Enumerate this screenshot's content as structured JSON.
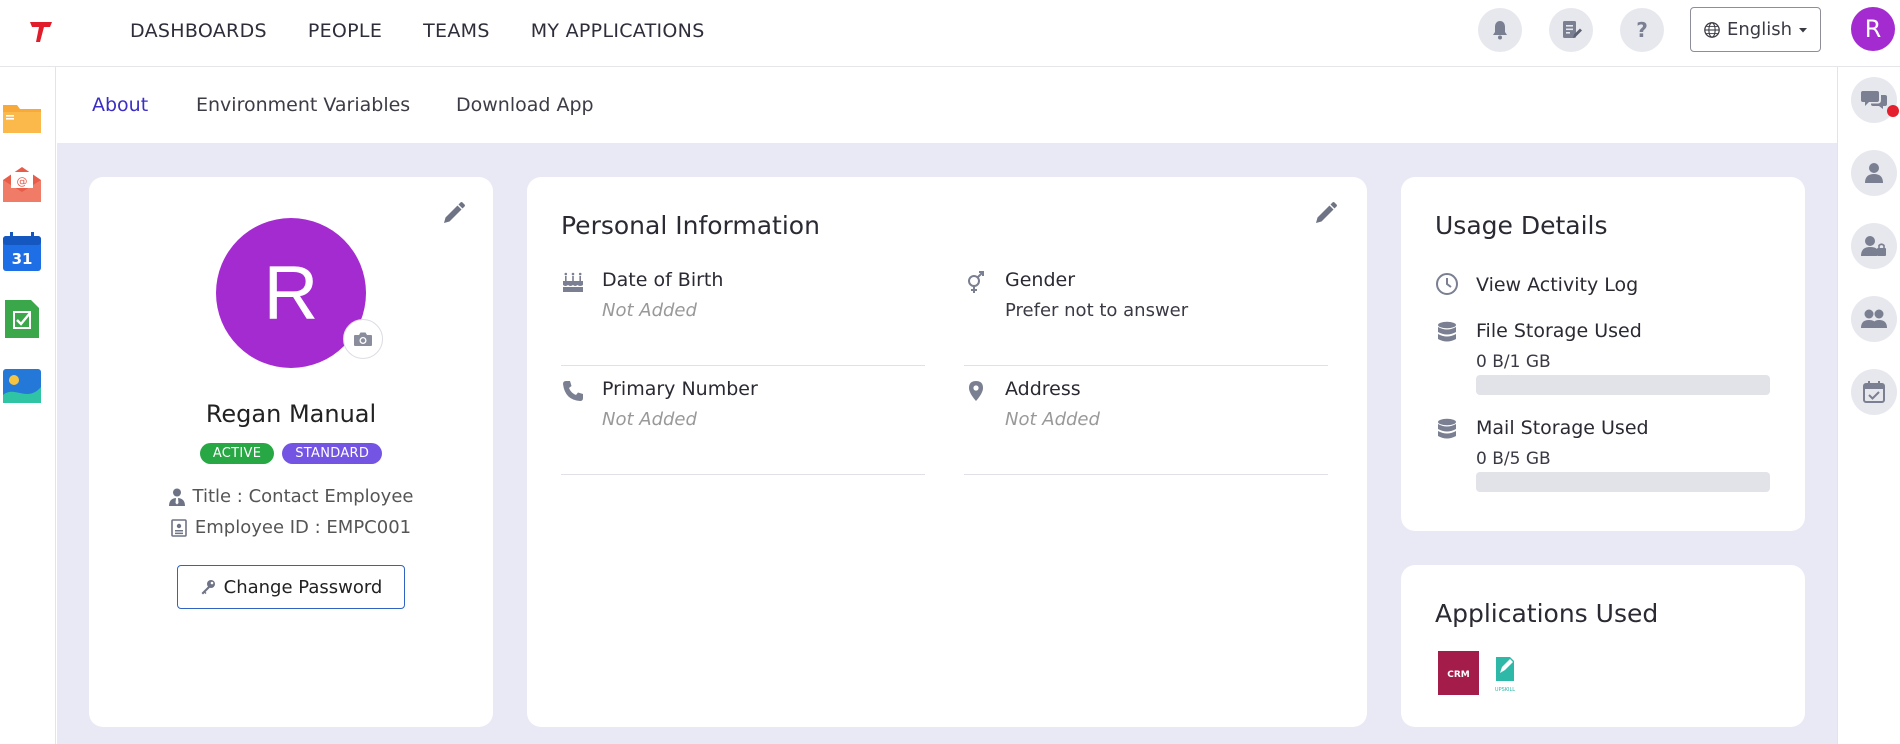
{
  "nav": {
    "items": [
      "DASHBOARDS",
      "PEOPLE",
      "TEAMS",
      "MY APPLICATIONS"
    ]
  },
  "topbar": {
    "language": "English",
    "user_initial": "R"
  },
  "tabs": [
    "About",
    "Environment Variables",
    "Download App"
  ],
  "profile": {
    "initial": "R",
    "name": "Regan Manual",
    "badges": [
      "ACTIVE",
      "STANDARD"
    ],
    "title": "Title : Contact Employee",
    "employee_id": "Employee ID : EMPC001",
    "change_password": "Change Password"
  },
  "personal_info": {
    "title": "Personal Information",
    "fields": [
      {
        "label": "Date of Birth",
        "value": "Not Added"
      },
      {
        "label": "Gender",
        "value": "Prefer not to answer"
      },
      {
        "label": "Primary Number",
        "value": "Not Added"
      },
      {
        "label": "Address",
        "value": "Not Added"
      }
    ]
  },
  "usage": {
    "title": "Usage Details",
    "activity_log": "View Activity Log",
    "file_storage": {
      "label": "File Storage Used",
      "value": "0 B/1 GB",
      "fraction": 0
    },
    "mail_storage": {
      "label": "Mail Storage Used",
      "value": "0 B/5 GB",
      "fraction": 0
    }
  },
  "applications": {
    "title": "Applications Used",
    "apps": [
      "CRM",
      "UPSKILL"
    ]
  },
  "colors": {
    "accent": "#3a2ec4",
    "avatar": "#a42bd0",
    "active_badge": "#28a745",
    "standard_badge": "#7354e3",
    "content_bg": "#e8e9f4"
  }
}
